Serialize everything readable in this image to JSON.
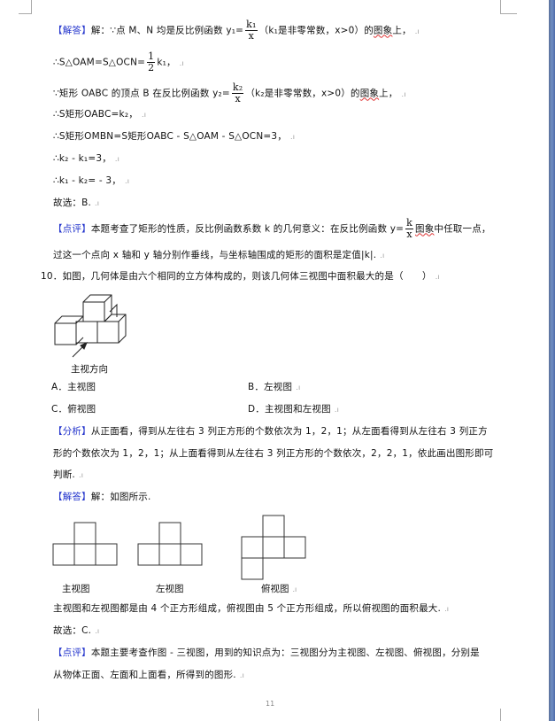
{
  "doc": {
    "page_number": "11",
    "para_mark": ".ı",
    "q9": {
      "answer_tag": "【解答】",
      "answer_intro": "解：∵点 M、N 均是反比例函数 y₁=",
      "line1_frac_num": "k₁",
      "line1_frac_den": "x",
      "line1_tail": "（k₁是非零常数，x>0）的",
      "line1_wavy": "图象",
      "line1_end": "上，",
      "line2_pre": "∴S△OAM=S△OCN=",
      "line2_frac_num": "1",
      "line2_frac_den": "2",
      "line2_tail": "k₁，",
      "line3_pre": "∵矩形 OABC 的顶点 B 在反比例函数 y₂=",
      "line3_frac_num": "k₂",
      "line3_frac_den": "x",
      "line3_tail": "（k₂是非零常数，x>0）的",
      "line3_wavy": "图象",
      "line3_end": "上，",
      "line4": "∴S矩形OABC=k₂，",
      "line5": "∴S矩形OMBN=S矩形OABC - S△OAM - S△OCN=3，",
      "line6": "∴k₂ - k₁=3，",
      "line7": "∴k₁ - k₂= - 3，",
      "line8": "故选：B.",
      "comment_tag": "【点评】",
      "comment_line1_pre": "本题考查了矩形的性质，反比例函数系数 k 的几何意义：在反比例函数 y=",
      "comment_frac_num": "k",
      "comment_frac_den": "x",
      "comment_wavy": "图象",
      "comment_line1_end": "中任取一点，",
      "comment_line2": "过这一个点向 x 轴和 y 轴分别作垂线，与坐标轴围成的矩形的面积是定值|k|."
    },
    "q10": {
      "question": "10．如图，几何体是由六个相同的立方体构成的，则该几何体三视图中面积最大的是（　　）",
      "figure_caption": "主视方向",
      "options": [
        {
          "label": "A．主视图"
        },
        {
          "label": "B．左视图"
        },
        {
          "label": "C．俯视图"
        },
        {
          "label": "D．主视图和左视图"
        }
      ],
      "analysis_tag": "【分析】",
      "analysis_line1": "从正面看，得到从左往右 3 列正方形的个数依次为 1，2，1；从左面看得到从左往右 3 列正方",
      "analysis_line2": "形的个数依次为 1，2，1；从上面看得到从左往右 3 列正方形的个数依次，2，2，1，依此画出图形即可",
      "analysis_line3": "判断.",
      "answer_tag": "【解答】",
      "answer_intro": "解：如图所示.",
      "view_labels": [
        "主视图",
        "左视图",
        "俯视图"
      ],
      "answer_line": "主视图和左视图都是由 4 个正方形组成，俯视图由 5 个正方形组成，所以俯视图的面积最大.",
      "choice": "故选：C.",
      "comment_tag": "【点评】",
      "comment_line1": "本题主要考查作图 - 三视图，用到的知识点为：三视图分为主视图、左视图、俯视图，分别是",
      "comment_line2": "从物体正面、左面和上面看，所得到的图形."
    }
  }
}
